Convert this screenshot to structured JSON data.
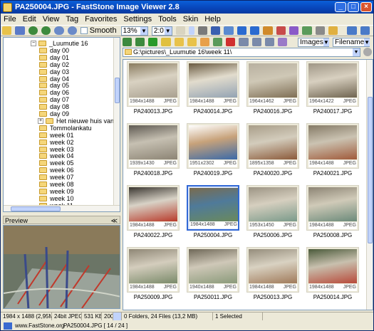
{
  "window": {
    "title": "PA250004.JPG  -  FastStone Image Viewer 2.8"
  },
  "menu": [
    "File",
    "Edit",
    "View",
    "Tag",
    "Favorites",
    "Settings",
    "Tools",
    "Skin",
    "Help"
  ],
  "toolbar": {
    "smooth_label": "Smooth",
    "zoom_value": "13%",
    "ratio_value": "2:0"
  },
  "tree": {
    "items": [
      {
        "label": "_Luumutie 16",
        "level": 0,
        "expander": "−"
      },
      {
        "label": "day 00",
        "level": 1
      },
      {
        "label": "day 01",
        "level": 1
      },
      {
        "label": "day 02",
        "level": 1
      },
      {
        "label": "day 03",
        "level": 1
      },
      {
        "label": "day 04",
        "level": 1
      },
      {
        "label": "day 05",
        "level": 1
      },
      {
        "label": "day 06",
        "level": 1
      },
      {
        "label": "day 07",
        "level": 1
      },
      {
        "label": "day 08",
        "level": 1
      },
      {
        "label": "day 09",
        "level": 1
      },
      {
        "label": "Het nieuwe huis van Tarja B",
        "level": 1,
        "expander": "+"
      },
      {
        "label": "Tommolankatu",
        "level": 1
      },
      {
        "label": "week 01",
        "level": 1
      },
      {
        "label": "week 02",
        "level": 1
      },
      {
        "label": "week 03",
        "level": 1
      },
      {
        "label": "week 04",
        "level": 1
      },
      {
        "label": "week 05",
        "level": 1
      },
      {
        "label": "week 06",
        "level": 1
      },
      {
        "label": "week 07",
        "level": 1
      },
      {
        "label": "week 08",
        "level": 1
      },
      {
        "label": "week 09",
        "level": 1
      },
      {
        "label": "week 10",
        "level": 1
      },
      {
        "label": "week 11",
        "level": 1
      }
    ]
  },
  "preview": {
    "label": "Preview"
  },
  "browser": {
    "address": "G:\\pictures\\_Luumutie 16\\week 11\\",
    "filter_value": "Images",
    "sort_value": "Filename"
  },
  "thumbnails": [
    {
      "name": "PA240013.JPG",
      "dims": "1984x1488",
      "type": "JPEG",
      "colors": [
        "#8a7c60",
        "#d9d2c2",
        "#a9a090"
      ]
    },
    {
      "name": "PA240014.JPG",
      "dims": "1984x1488",
      "type": "JPEG",
      "colors": [
        "#6a5a40",
        "#e2dccd",
        "#93a3b3"
      ]
    },
    {
      "name": "PA240016.JPG",
      "dims": "1964x1462",
      "type": "JPEG",
      "colors": [
        "#b8b0a0",
        "#cfc8b6",
        "#7f6f55"
      ]
    },
    {
      "name": "PA240017.JPG",
      "dims": "1964x1422",
      "type": "JPEG",
      "colors": [
        "#9f9686",
        "#d8d0c0",
        "#6f6450"
      ]
    },
    {
      "name": "PA240018.JPG",
      "dims": "1939x1430",
      "type": "JPEG",
      "colors": [
        "#5f5a52",
        "#c6c0b2",
        "#8c8474"
      ]
    },
    {
      "name": "PA240019.JPG",
      "dims": "1951x2302",
      "type": "JPEG",
      "colors": [
        "#ffffff",
        "#c7a27a",
        "#3b6aa8"
      ]
    },
    {
      "name": "PA240020.JPG",
      "dims": "1895x1358",
      "type": "JPEG",
      "colors": [
        "#a89d88",
        "#d3ccbc",
        "#8b5a3a"
      ]
    },
    {
      "name": "PA240021.JPG",
      "dims": "1984x1488",
      "type": "JPEG",
      "colors": [
        "#857a66",
        "#cbc3b2",
        "#a05a3a"
      ]
    },
    {
      "name": "PA240022.JPG",
      "dims": "1984x1488",
      "type": "JPEG",
      "colors": [
        "#3a3630",
        "#d8d2c6",
        "#b83a2a"
      ]
    },
    {
      "name": "PA250004.JPG",
      "dims": "1984x1488",
      "type": "JPEG",
      "colors": [
        "#7a6b4d",
        "#4f7a9a",
        "#6b8a5a"
      ]
    },
    {
      "name": "PA250006.JPG",
      "dims": "1953x1450",
      "type": "JPEG",
      "colors": [
        "#9c9484",
        "#d6cfbf",
        "#7a9a8a"
      ]
    },
    {
      "name": "PA250008.JPG",
      "dims": "1984x1488",
      "type": "JPEG",
      "colors": [
        "#8c8474",
        "#d0cab8",
        "#6b8a7a"
      ]
    },
    {
      "name": "PA250009.JPG",
      "dims": "1984x1488",
      "type": "JPEG",
      "colors": [
        "#8f8776",
        "#d4cdbd",
        "#7a8a6a"
      ]
    },
    {
      "name": "PA250011.JPG",
      "dims": "1940x1488",
      "type": "JPEG",
      "colors": [
        "#6f6858",
        "#cfc8b8",
        "#8a9a7a"
      ]
    },
    {
      "name": "PA250013.JPG",
      "dims": "1984x1488",
      "type": "JPEG",
      "colors": [
        "#958d7c",
        "#d9d2c2",
        "#a07a5a"
      ]
    },
    {
      "name": "PA250014.JPG",
      "dims": "1984x1488",
      "type": "JPEG",
      "colors": [
        "#4a5a3a",
        "#c8c0ae",
        "#b84a3a"
      ]
    }
  ],
  "selected_index": 9,
  "status": {
    "image_info": "1984 x 1488 (2,95MP)",
    "bit_depth": "24bit JPEG",
    "file_size": "531 KB",
    "year": "2006",
    "folder_summary": "0 Folders, 24 Files (13,2 MB)",
    "selection": "1 Selected"
  },
  "bottom": {
    "url": "www.FastStone.org",
    "file_position": "PA250004.JPG [ 14 / 24 ]"
  }
}
